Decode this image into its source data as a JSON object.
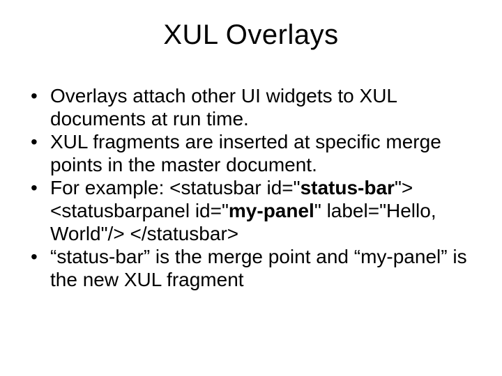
{
  "title": "XUL Overlays",
  "bullets": [
    {
      "pre": "Overlays attach other UI widgets to XUL documents at run time."
    },
    {
      "pre": "XUL fragments are inserted at specific merge points in the master document."
    },
    {
      "pre": "For example: <statusbar id=\"",
      "bold1": "status-bar",
      "mid1": "\"> <statusbarpanel id=\"",
      "bold2": "my-panel",
      "mid2": "\" label=\"Hello, World\"/> </statusbar>"
    },
    {
      "pre": "“status-bar” is the merge point and “my-panel” is the new XUL fragment"
    }
  ]
}
